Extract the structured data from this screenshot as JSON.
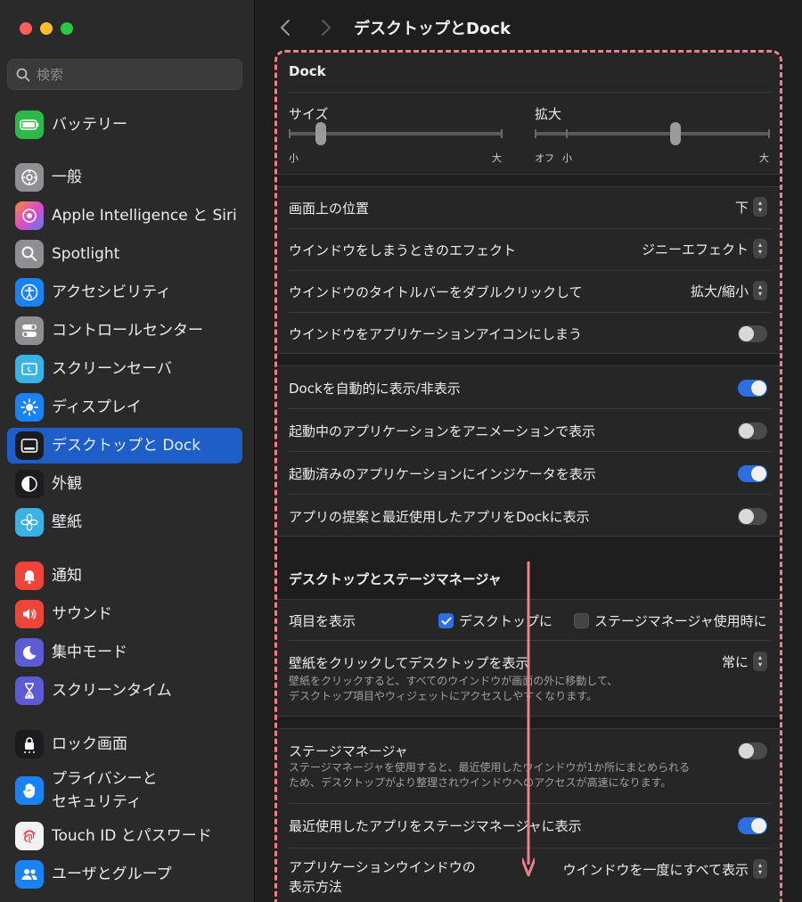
{
  "window": {
    "title": "デスクトップとDock"
  },
  "search": {
    "placeholder": "検索"
  },
  "sidebar": {
    "items": [
      {
        "label": "バッテリー",
        "icon": "battery-icon",
        "color": "#2fb84a"
      },
      {
        "label": "一般",
        "icon": "gear-icon",
        "color": "#8e8e93"
      },
      {
        "label": "Apple Intelligence と Siri",
        "icon": "siri-icon",
        "color": "#c45cf0"
      },
      {
        "label": "Spotlight",
        "icon": "magnifier-icon",
        "color": "#8e8e93"
      },
      {
        "label": "アクセシビリティ",
        "icon": "accessibility-icon",
        "color": "#1a82f7"
      },
      {
        "label": "コントロールセンター",
        "icon": "switches-icon",
        "color": "#8e8e93"
      },
      {
        "label": "スクリーンセーバ",
        "icon": "screensaver-icon",
        "color": "#38b3e6"
      },
      {
        "label": "ディスプレイ",
        "icon": "sun-icon",
        "color": "#1a82f7"
      },
      {
        "label": "デスクトップと Dock",
        "icon": "dock-icon",
        "color": "#1c1c1e",
        "selected": true
      },
      {
        "label": "外観",
        "icon": "appearance-icon",
        "color": "#1c1c1e"
      },
      {
        "label": "壁紙",
        "icon": "flower-icon",
        "color": "#3ab2e6"
      },
      {
        "label": "通知",
        "icon": "bell-icon",
        "color": "#f0443a"
      },
      {
        "label": "サウンド",
        "icon": "speaker-icon",
        "color": "#f0443a"
      },
      {
        "label": "集中モード",
        "icon": "moon-icon",
        "color": "#5b5bd6"
      },
      {
        "label": "スクリーンタイム",
        "icon": "hourglass-icon",
        "color": "#5b5bd6"
      },
      {
        "label": "ロック画面",
        "icon": "lock-icon",
        "color": "#1c1c1e"
      },
      {
        "label": "プライバシーと\nセキュリティ",
        "line1": "プライバシーと",
        "line2": "セキュリティ",
        "icon": "hand-icon",
        "color": "#1a82f7"
      },
      {
        "label": "Touch ID とパスワード",
        "icon": "fingerprint-icon",
        "color": "#f2f2f2"
      },
      {
        "label": "ユーザとグループ",
        "icon": "users-icon",
        "color": "#1a82f7"
      }
    ]
  },
  "dock": {
    "heading": "Dock",
    "size_label": "サイズ",
    "size_min": "小",
    "size_max": "大",
    "size_value": 0.15,
    "mag_label": "拡大",
    "mag_off": "オフ",
    "mag_min": "小",
    "mag_max": "大",
    "mag_value": 0.6,
    "position_label": "画面上の位置",
    "position_value": "下",
    "minimize_label": "ウインドウをしまうときのエフェクト",
    "minimize_value": "ジニーエフェクト",
    "doubleclick_label": "ウインドウのタイトルバーをダブルクリックして",
    "doubleclick_value": "拡大/縮小",
    "minimize_to_app_label": "ウインドウをアプリケーションアイコンにしまう",
    "minimize_to_app": false,
    "autohide_label": "Dockを自動的に表示/非表示",
    "autohide": true,
    "animate_label": "起動中のアプリケーションをアニメーションで表示",
    "animate": false,
    "indicators_label": "起動済みのアプリケーションにインジケータを表示",
    "indicators": true,
    "suggest_label": "アプリの提案と最近使用したアプリをDockに表示",
    "suggest": false
  },
  "stage": {
    "heading": "デスクトップとステージマネージャ",
    "show_items_label": "項目を表示",
    "show_desktop_label": "デスクトップに",
    "show_desktop": true,
    "show_stage_label": "ステージマネージャ使用時に",
    "show_stage": false,
    "click_wallpaper_label": "壁紙をクリックしてデスクトップを表示",
    "click_wallpaper_value": "常に",
    "click_wallpaper_sub1": "壁紙をクリックすると、すべてのウインドウが画面の外に移動して、",
    "click_wallpaper_sub2": "デスクトップ項目やウィジェットにアクセスしやすくなります。",
    "stage_manager_label": "ステージマネージャ",
    "stage_manager": false,
    "stage_sub1": "ステージマネージャを使用すると、最近使用したウインドウが1か所にまとめられる",
    "stage_sub2": "ため、デスクトップがより整理されウインドウへのアクセスが高速になります。",
    "recent_apps_label": "最近使用したアプリをステージマネージャに表示",
    "recent_apps": true,
    "app_windows_label1": "アプリケーションウインドウの",
    "app_windows_label2": "表示方法",
    "app_windows_value": "ウインドウを一度にすべて表示"
  },
  "colors": {
    "accent": "#2b6fe0",
    "selection": "#1d5ec8",
    "annotation": "#f07f8a"
  }
}
